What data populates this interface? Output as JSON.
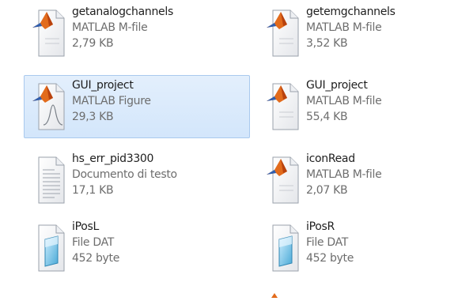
{
  "files": [
    {
      "name": "getanalogchannels",
      "type": "MATLAB M-file",
      "size": "2,79 KB",
      "icon": "matlab-m-file-icon"
    },
    {
      "name": "getemgchannels",
      "type": "MATLAB M-file",
      "size": "3,52 KB",
      "icon": "matlab-m-file-icon"
    },
    {
      "name": "GUI_project",
      "type": "MATLAB Figure",
      "size": "29,3 KB",
      "icon": "matlab-figure-icon",
      "selected": true
    },
    {
      "name": "GUI_project",
      "type": "MATLAB M-file",
      "size": "55,4 KB",
      "icon": "matlab-m-file-icon"
    },
    {
      "name": "hs_err_pid3300",
      "type": "Documento di testo",
      "size": "17,1 KB",
      "icon": "text-document-icon"
    },
    {
      "name": "iconRead",
      "type": "MATLAB M-file",
      "size": "2,07 KB",
      "icon": "matlab-m-file-icon"
    },
    {
      "name": "iPosL",
      "type": "File DAT",
      "size": "452 byte",
      "icon": "dat-file-icon"
    },
    {
      "name": "iPosR",
      "type": "File DAT",
      "size": "452 byte",
      "icon": "dat-file-icon"
    }
  ],
  "colors": {
    "selection": "#d9e8fb",
    "matlab_orange": "#e26b1c",
    "matlab_blue": "#2f5fb0"
  }
}
